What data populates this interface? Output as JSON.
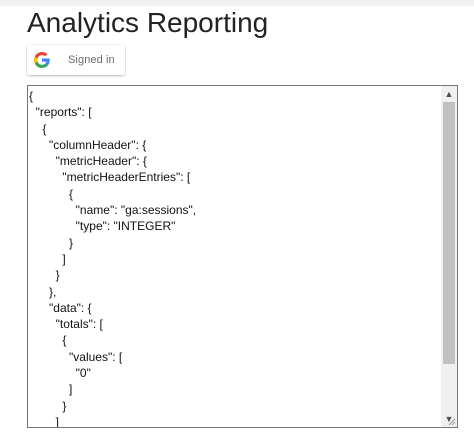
{
  "header": {
    "title": "Analytics Reporting"
  },
  "signin_button": {
    "icon": "google-g-icon",
    "label": "Signed in"
  },
  "response_textarea": {
    "lines": [
      "{",
      "  \"reports\": [",
      "    {",
      "      \"columnHeader\": {",
      "        \"metricHeader\": {",
      "          \"metricHeaderEntries\": [",
      "            {",
      "              \"name\": \"ga:sessions\",",
      "              \"type\": \"INTEGER\"",
      "            }",
      "          ]",
      "        }",
      "      },",
      "      \"data\": {",
      "        \"totals\": [",
      "          {",
      "            \"values\": [",
      "              \"0\"",
      "            ]",
      "          }",
      "        ]"
    ]
  },
  "colors": {
    "google_blue": "#4285F4",
    "google_red": "#EA4335",
    "google_yellow": "#FBBC05",
    "google_green": "#34A853"
  }
}
